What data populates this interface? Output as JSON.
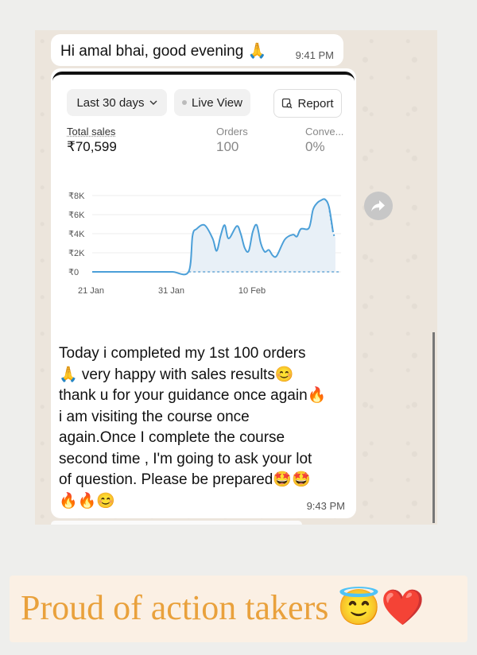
{
  "chat": {
    "greeting": {
      "text": "Hi amal bhai, good evening 🙏",
      "time": "9:41 PM"
    },
    "reply": {
      "time": "9:43 PM",
      "lines": [
        "Today i completed my 1st 100 orders",
        "🙏 very happy with sales results😊",
        "thank u for your guidance once again🔥",
        "i am visiting the course once",
        "again.Once I complete the course",
        "second time , I'm going to ask your lot",
        "of question. Please be prepared🤩🤩",
        "🔥🔥😊"
      ]
    }
  },
  "dashboard": {
    "range_label": "Last 30 days",
    "live_label": "Live View",
    "report_label": "Report",
    "metrics": [
      {
        "label": "Total sales",
        "value": "₹70,599"
      },
      {
        "label": "Orders",
        "value": "100"
      },
      {
        "label": "Conve...",
        "value": "0%"
      }
    ]
  },
  "chart_data": {
    "type": "line",
    "title": "",
    "xlabel": "",
    "ylabel": "",
    "ylim": [
      0,
      8000
    ],
    "y_ticks": [
      "₹0",
      "₹2K",
      "₹4K",
      "₹6K",
      "₹8K"
    ],
    "x_ticks": [
      "21 Jan",
      "31 Jan",
      "10 Feb"
    ],
    "grid": true,
    "x": [
      0,
      2,
      4,
      6,
      8,
      10,
      12,
      12.5,
      13,
      14,
      15,
      15.5,
      16,
      16.5,
      17,
      18,
      18.5,
      19,
      19.5,
      20,
      20.5,
      21,
      21.5,
      22,
      22.5,
      23,
      24,
      25,
      25.5,
      26,
      27,
      27.5,
      28,
      28.5,
      29,
      29.5,
      30,
      30.3
    ],
    "series": [
      {
        "values": [
          0,
          0,
          0,
          0,
          0,
          0,
          0,
          3800,
          4500,
          4900,
          3500,
          2200,
          3800,
          4900,
          3500,
          4800,
          4000,
          2500,
          2200,
          4200,
          4900,
          3000,
          2100,
          2300,
          1700,
          1700,
          3400,
          3900,
          3700,
          4500,
          4600,
          6500,
          7200,
          7500,
          7600,
          6800,
          4200,
          3600
        ]
      }
    ]
  },
  "banner": {
    "text": "Proud of action takers 😇❤️"
  }
}
